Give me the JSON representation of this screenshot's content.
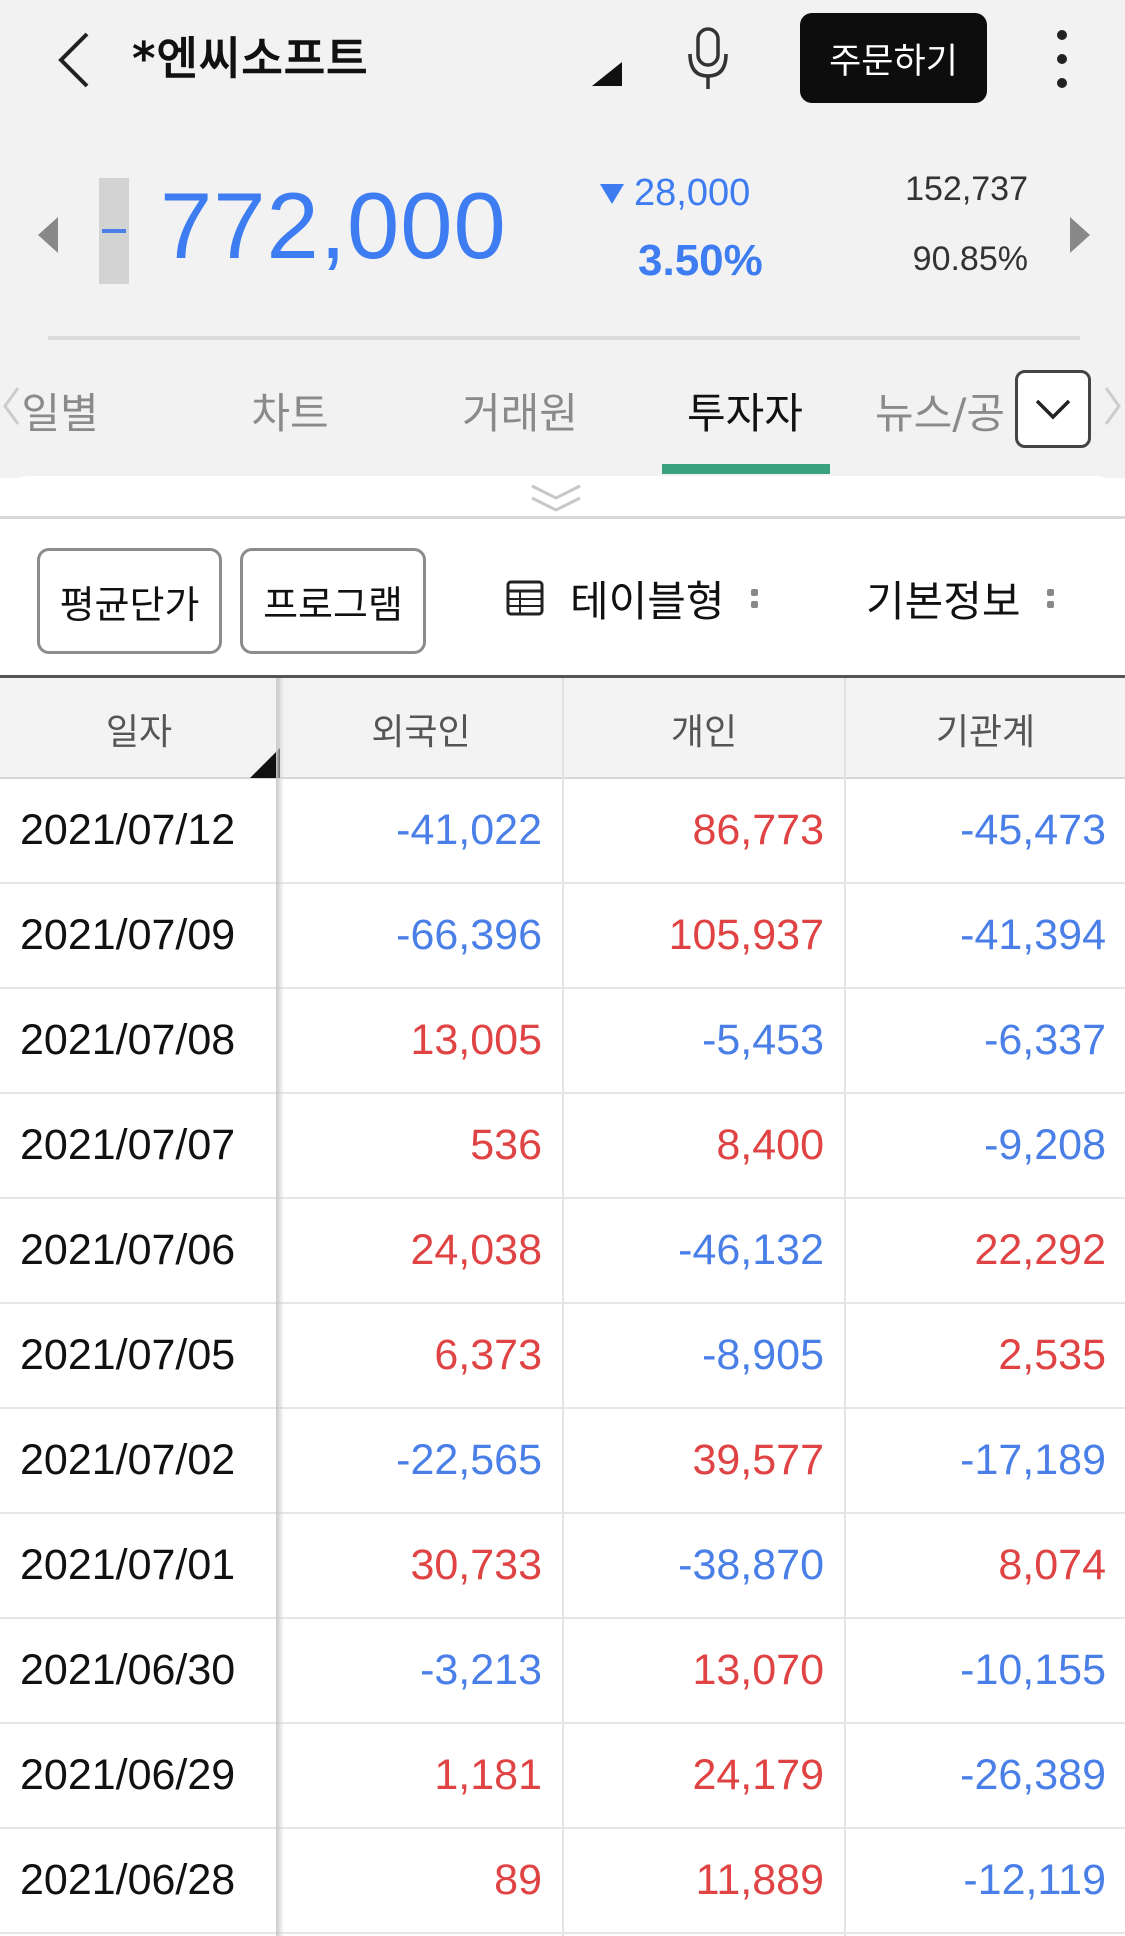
{
  "header": {
    "title": "*엔씨소프트",
    "order_label": "주문하기"
  },
  "quote": {
    "price": "772,000",
    "change": "28,000",
    "change_pct": "3.50%",
    "volume": "152,737",
    "volume_pct": "90.85%",
    "direction": "down",
    "color_down": "#3d7cf1",
    "color_up": "#e04343"
  },
  "tabs": [
    {
      "label": "일별",
      "active": false
    },
    {
      "label": "차트",
      "active": false
    },
    {
      "label": "거래원",
      "active": false
    },
    {
      "label": "투자자",
      "active": true
    },
    {
      "label": "뉴스/공",
      "active": false
    }
  ],
  "options": {
    "avg_price": "평균단가",
    "program": "프로그램",
    "table_type": "테이블형",
    "basic_info": "기본정보"
  },
  "table": {
    "columns": [
      "일자",
      "외국인",
      "개인",
      "기관계"
    ],
    "rows": [
      {
        "date": "2021/07/12",
        "foreign": "-41,022",
        "individual": "86,773",
        "institution": "-45,473"
      },
      {
        "date": "2021/07/09",
        "foreign": "-66,396",
        "individual": "105,937",
        "institution": "-41,394"
      },
      {
        "date": "2021/07/08",
        "foreign": "13,005",
        "individual": "-5,453",
        "institution": "-6,337"
      },
      {
        "date": "2021/07/07",
        "foreign": "536",
        "individual": "8,400",
        "institution": "-9,208"
      },
      {
        "date": "2021/07/06",
        "foreign": "24,038",
        "individual": "-46,132",
        "institution": "22,292"
      },
      {
        "date": "2021/07/05",
        "foreign": "6,373",
        "individual": "-8,905",
        "institution": "2,535"
      },
      {
        "date": "2021/07/02",
        "foreign": "-22,565",
        "individual": "39,577",
        "institution": "-17,189"
      },
      {
        "date": "2021/07/01",
        "foreign": "30,733",
        "individual": "-38,870",
        "institution": "8,074"
      },
      {
        "date": "2021/06/30",
        "foreign": "-3,213",
        "individual": "13,070",
        "institution": "-10,155"
      },
      {
        "date": "2021/06/29",
        "foreign": "1,181",
        "individual": "24,179",
        "institution": "-26,389"
      },
      {
        "date": "2021/06/28",
        "foreign": "89",
        "individual": "11,889",
        "institution": "-12,119"
      }
    ]
  }
}
